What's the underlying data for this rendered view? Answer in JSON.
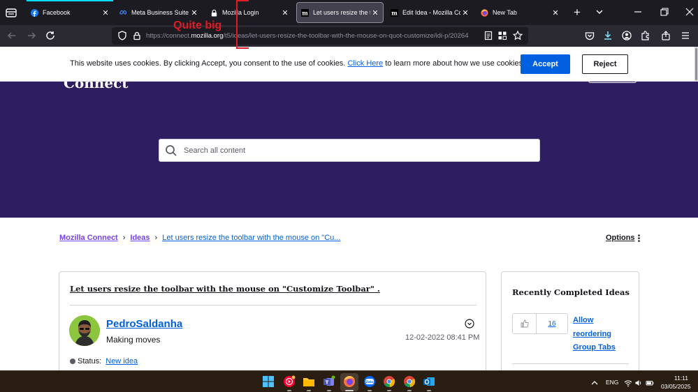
{
  "browser": {
    "tabs": [
      {
        "title": "Facebook",
        "favicon": "facebook-icon"
      },
      {
        "title": "Meta Business Suite",
        "favicon": "meta-icon"
      },
      {
        "title": "Mozilla Login",
        "favicon": "lock-icon"
      },
      {
        "title": "Let users resize the toolb",
        "favicon": "mozilla-m-icon",
        "active": true
      },
      {
        "title": "Edit Idea - Mozilla Conn",
        "favicon": "mozilla-m-icon"
      },
      {
        "title": "New Tab",
        "favicon": "firefox-icon"
      }
    ],
    "url": {
      "prefix": "https://connect.",
      "host": "mozilla.org",
      "path": "/t5/ideas/let-users-resize-the-toolbar-with-the-mouse-on-quot-customize/idi-p/20264"
    },
    "annotation": "Quite big"
  },
  "cookie_banner": {
    "text": "This website uses cookies. By clicking Accept, you consent to the use of cookies.",
    "link": "Click Here",
    "text_after": "to learn more about how we use cookies.",
    "accept": "Accept",
    "reject": "Reject"
  },
  "hero": {
    "logo_text": "Connect",
    "search_placeholder": "Search all content"
  },
  "breadcrumb": {
    "items": [
      "Mozilla Connect",
      "Ideas",
      "Let users resize the toolbar with the mouse on \"Cu..."
    ],
    "options": "Options"
  },
  "idea": {
    "title": "Let users resize the toolbar with the mouse on \"Customize Toolbar\" .",
    "author": "PedroSaldanha",
    "rank": "Making moves",
    "date": "12-02-2022",
    "time": "08:41 PM",
    "status_label": "Status:",
    "status_value": "New idea"
  },
  "sidebar": {
    "title": "Recently Completed Ideas",
    "items": [
      {
        "kudos": "16",
        "label": "Allow reordering Group Tabs"
      }
    ]
  },
  "taskbar": {
    "language": "ENG",
    "time": "11:11",
    "date": "03/05/2025"
  },
  "colors": {
    "hero": "#2f1d61",
    "accent": "#0060df",
    "annotation": "#e01b24",
    "breadcrumb_root": "#7542e5"
  }
}
